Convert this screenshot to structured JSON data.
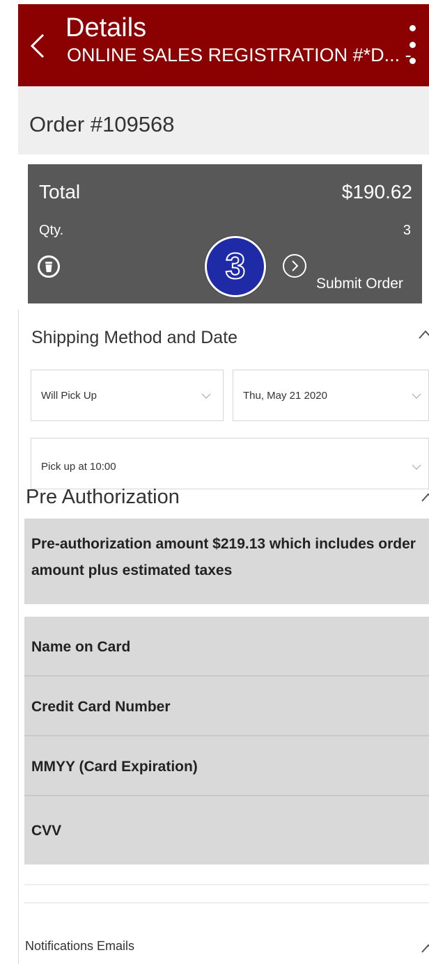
{
  "header": {
    "title": "Details",
    "subtitle": "ONLINE SALES REGISTRATION #*D... -",
    "icons": {
      "back": "chevron-left-icon",
      "menu": "kebab-menu-icon"
    }
  },
  "order": {
    "title": "Order #109568"
  },
  "summary": {
    "total_label": "Total",
    "total_value": "$190.62",
    "qty_label": "Qty.",
    "qty_value": "3",
    "step_badge": "3",
    "submit_label": "Submit Order",
    "icons": {
      "delete": "trash-icon",
      "submit": "chevron-right-circle-icon"
    }
  },
  "shipping": {
    "title": "Shipping Method and Date",
    "method": "Will Pick Up",
    "date": "Thu, May 21 2020",
    "time": "Pick up at 10:00"
  },
  "preauth": {
    "title": "Pre Authorization",
    "message": "Pre-authorization amount $219.13 which includes order amount plus estimated taxes",
    "fields": [
      {
        "label": "Name on Card"
      },
      {
        "label": "Credit Card Number"
      },
      {
        "label": "MMYY (Card Expiration)"
      },
      {
        "label": "CVV"
      }
    ]
  },
  "notifications": {
    "title": "Notifications Emails"
  },
  "colors": {
    "header": "#8b0000",
    "summary": "#585858",
    "badge": "#1f2aa6",
    "field_bg": "#d9d9d9"
  }
}
